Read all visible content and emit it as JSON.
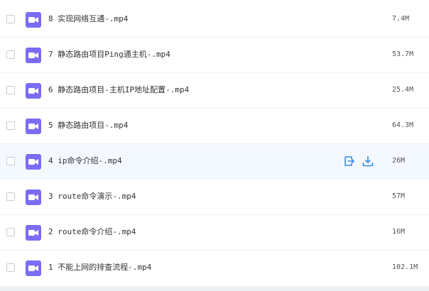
{
  "colors": {
    "file_icon": "#7b6cf6",
    "action_icon": "#3a8be8",
    "hover_row": "#f4f9ff"
  },
  "icons": {
    "file": "video-file-icon",
    "move": "move-to-icon",
    "download": "download-icon"
  },
  "files": [
    {
      "name": "8 实现网络互通-.mp4",
      "size": "7.4M"
    },
    {
      "name": "7 静态路由项目Ping通主机-.mp4",
      "size": "53.7M"
    },
    {
      "name": "6 静态路由项目-主机IP地址配置-.mp4",
      "size": "25.4M"
    },
    {
      "name": "5 静态路由项目-.mp4",
      "size": "64.3M"
    },
    {
      "name": "4 ip命令介绍-.mp4",
      "size": "26M"
    },
    {
      "name": "3 route命令演示-.mp4",
      "size": "57M"
    },
    {
      "name": "2 route命令介绍-.mp4",
      "size": "16M"
    },
    {
      "name": "1 不能上网的排查流程-.mp4",
      "size": "102.1M"
    }
  ]
}
